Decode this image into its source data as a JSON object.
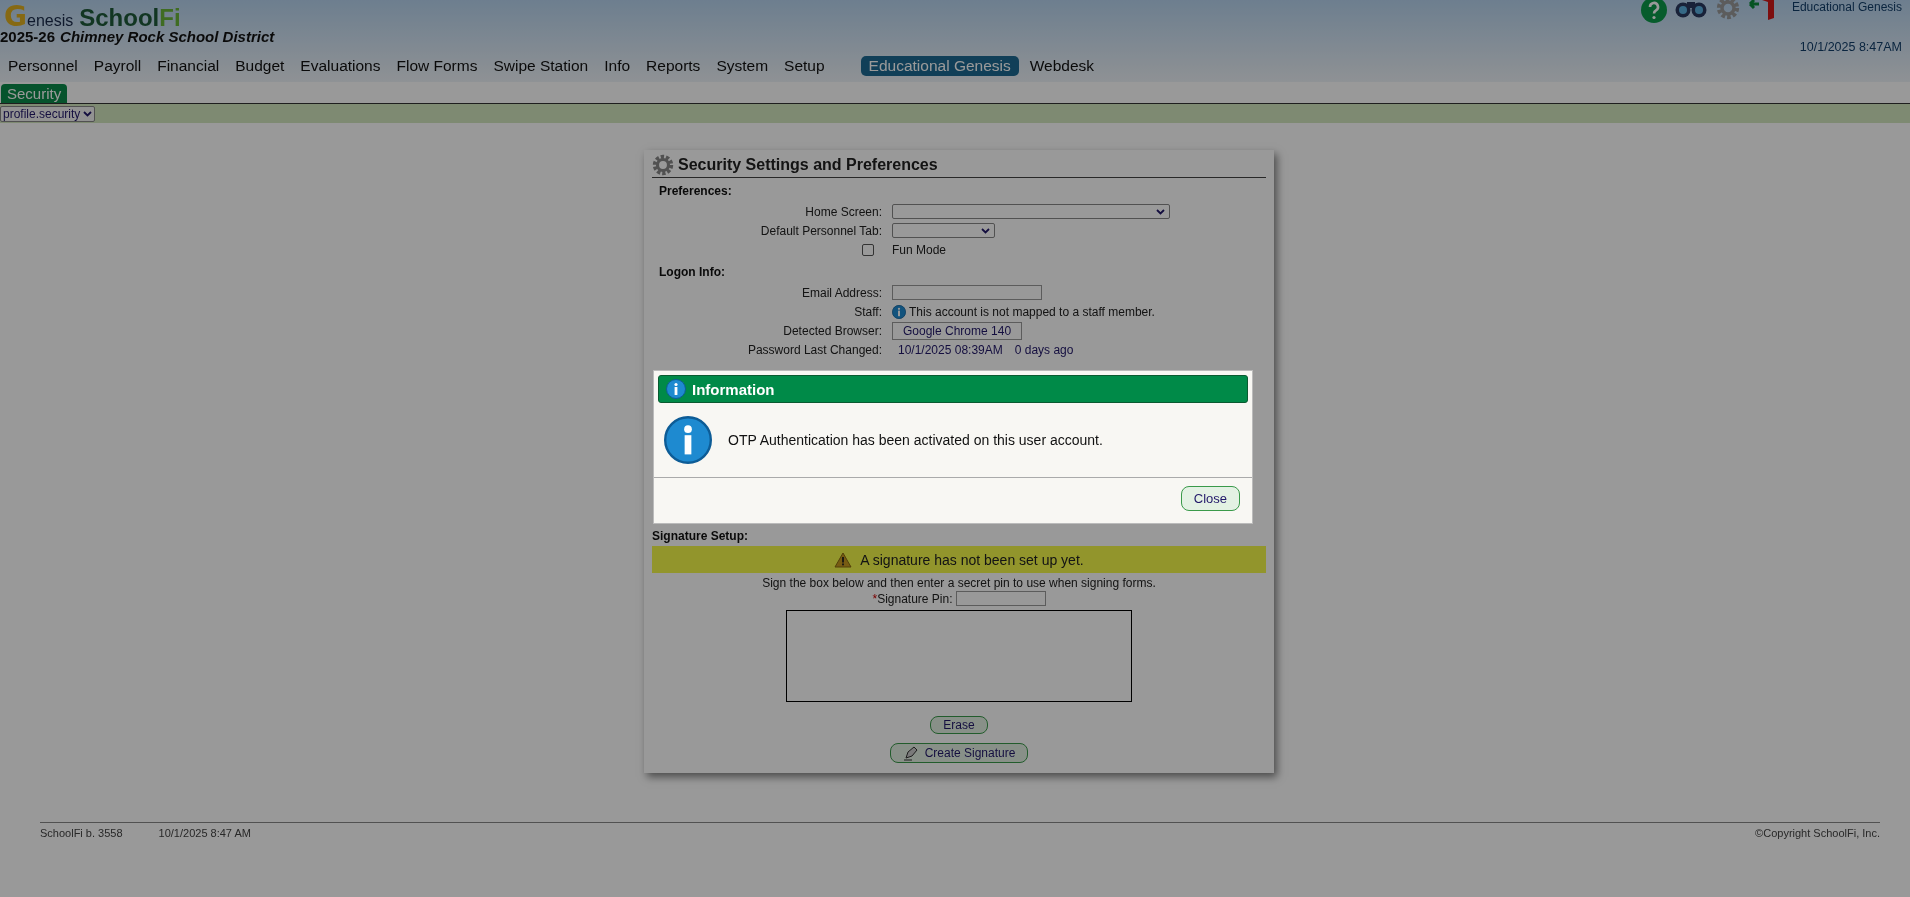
{
  "header": {
    "logo": {
      "mark": "G",
      "rest": "enesis",
      "product": "School",
      "product_accent": "Fi"
    },
    "district_year": "2025-26",
    "district_name": "Chimney Rock School District",
    "user_module": "Educational Genesis",
    "datetime": "10/1/2025 8:47AM"
  },
  "menu": [
    {
      "label": "Personnel",
      "selected": false
    },
    {
      "label": "Payroll",
      "selected": false
    },
    {
      "label": "Financial",
      "selected": false
    },
    {
      "label": "Budget",
      "selected": false
    },
    {
      "label": "Evaluations",
      "selected": false
    },
    {
      "label": "Flow Forms",
      "selected": false
    },
    {
      "label": "Swipe Station",
      "selected": false
    },
    {
      "label": "Info",
      "selected": false
    },
    {
      "label": "Reports",
      "selected": false
    },
    {
      "label": "System",
      "selected": false
    },
    {
      "label": "Setup",
      "selected": false
    },
    {
      "label": "Educational Genesis",
      "selected": true
    },
    {
      "label": "Webdesk",
      "selected": false
    }
  ],
  "subtabs": [
    {
      "label": "Security",
      "selected": true
    }
  ],
  "profile_select": {
    "value": "profile.security"
  },
  "panel": {
    "title": "Security Settings and Preferences",
    "preferences": {
      "heading": "Preferences:",
      "home_screen_label": "Home Screen:",
      "default_tab_label": "Default Personnel Tab:",
      "fun_mode": {
        "label": "Fun Mode",
        "checked": false
      }
    },
    "logon": {
      "heading": "Logon Info:",
      "email_label": "Email Address:",
      "staff_label": "Staff:",
      "staff_note": "This account is not mapped to a staff member.",
      "browser_label": "Detected Browser:",
      "browser": "Google Chrome 140",
      "password_label": "Password Last Changed:",
      "password_changed": "10/1/2025 08:39AM",
      "password_age": "0 days ago"
    },
    "signature": {
      "heading": "Signature Setup:",
      "warning": "A signature has not been set up yet.",
      "instructions": "Sign the box below and then enter a secret pin to use when signing forms.",
      "required_mark": "*",
      "pin_label": "Signature Pin:",
      "erase": "Erase",
      "create": "Create Signature"
    }
  },
  "dialog": {
    "title": "Information",
    "message": "OTP Authentication has been activated on this user account.",
    "button": "Close"
  },
  "footer": {
    "build": "SchoolFi b. 3558",
    "datetime": "10/1/2025 8:47 AM",
    "copyright": "©Copyright SchoolFi, Inc."
  }
}
